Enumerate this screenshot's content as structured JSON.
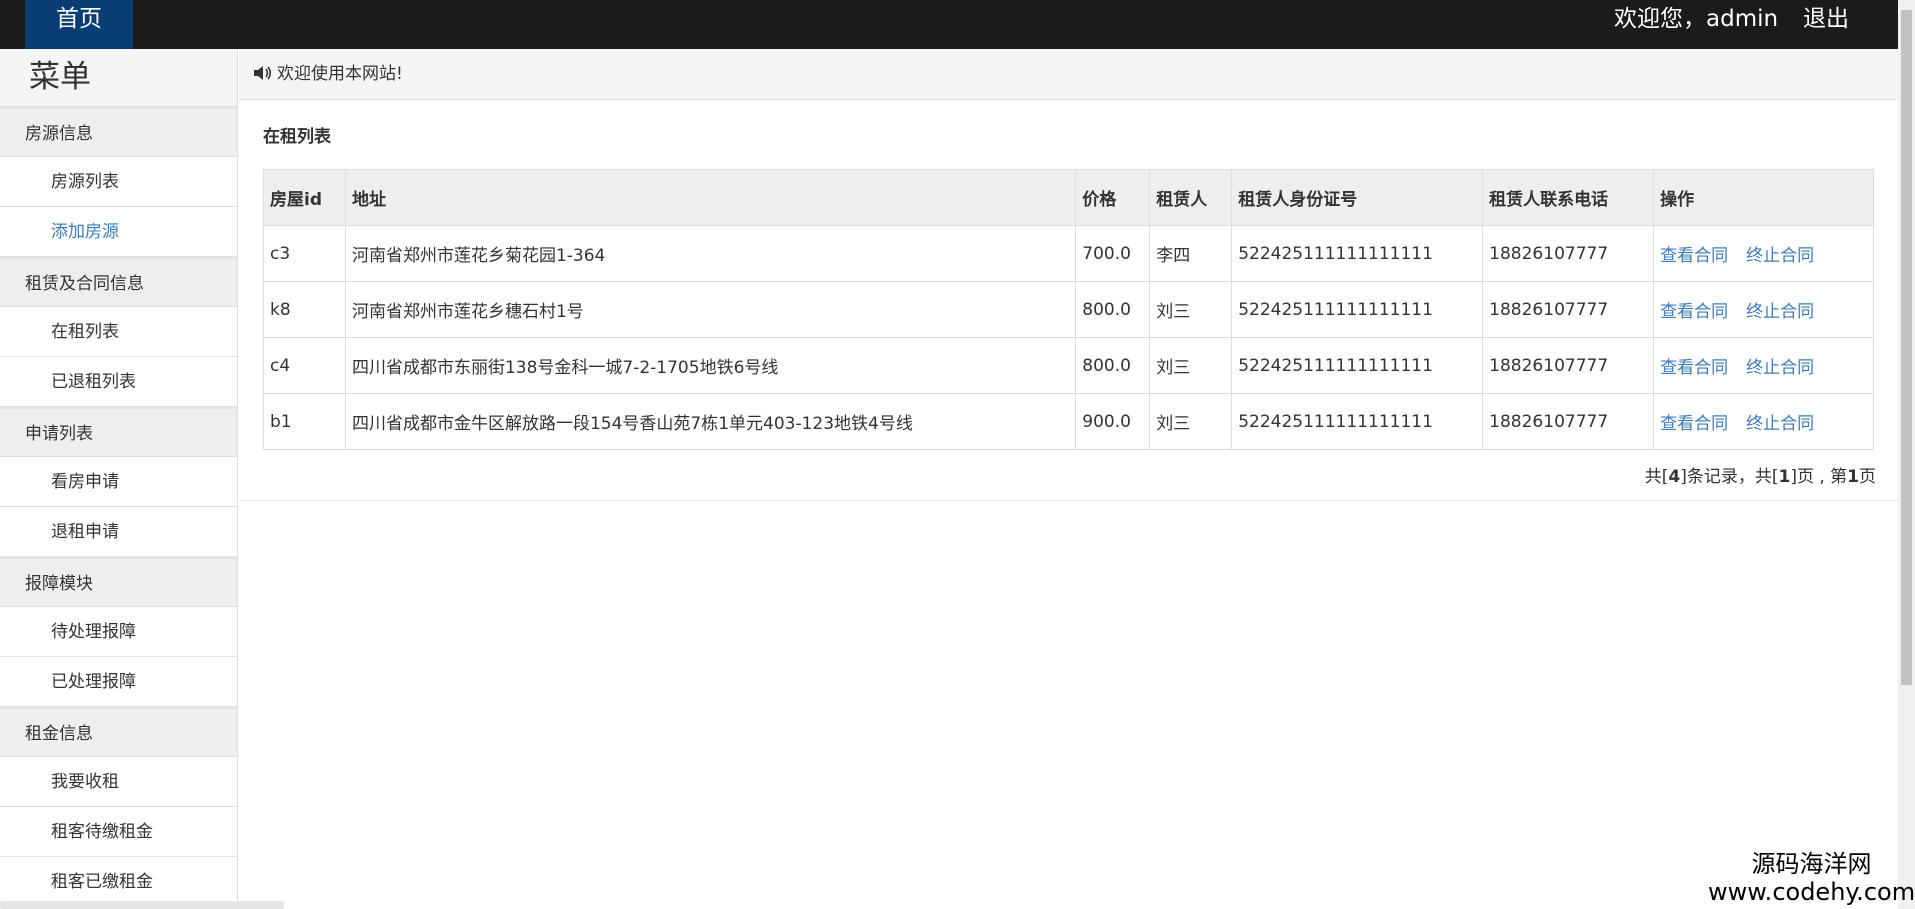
{
  "topbar": {
    "home_label": "首页",
    "welcome_text": "欢迎您，admin",
    "logout_label": "退出"
  },
  "sidebar": {
    "menu_title": "菜单",
    "groups": [
      {
        "label": "房源信息",
        "items": [
          {
            "label": "房源列表"
          },
          {
            "label": "添加房源"
          }
        ]
      },
      {
        "label": "租赁及合同信息",
        "items": [
          {
            "label": "在租列表"
          },
          {
            "label": "已退租列表"
          }
        ]
      },
      {
        "label": "申请列表",
        "items": [
          {
            "label": "看房申请"
          },
          {
            "label": "退租申请"
          }
        ]
      },
      {
        "label": "报障模块",
        "items": [
          {
            "label": "待处理报障"
          },
          {
            "label": "已处理报障"
          }
        ]
      },
      {
        "label": "租金信息",
        "items": [
          {
            "label": "我要收租"
          },
          {
            "label": "租客待缴租金"
          },
          {
            "label": "租客已缴租金"
          }
        ]
      }
    ]
  },
  "notice": {
    "icon": "speaker-icon",
    "text": "欢迎使用本网站!"
  },
  "panel": {
    "title": "在租列表",
    "columns": [
      "房屋id",
      "地址",
      "价格",
      "租赁人",
      "租赁人身份证号",
      "租赁人联系电话",
      "操作"
    ],
    "rows": [
      {
        "id": "c3",
        "address": "河南省郑州市莲花乡菊花园1-364",
        "price": "700.0",
        "tenant": "李四",
        "idcard": "522425111111111111",
        "phone": "18826107777",
        "view": "查看合同",
        "stop": "终止合同"
      },
      {
        "id": "k8",
        "address": "河南省郑州市莲花乡穗石村1号",
        "price": "800.0",
        "tenant": "刘三",
        "idcard": "522425111111111111",
        "phone": "18826107777",
        "view": "查看合同",
        "stop": "终止合同"
      },
      {
        "id": "c4",
        "address": "四川省成都市东丽街138号金科一城7-2-1705地铁6号线",
        "price": "800.0",
        "tenant": "刘三",
        "idcard": "522425111111111111",
        "phone": "18826107777",
        "view": "查看合同",
        "stop": "终止合同"
      },
      {
        "id": "b1",
        "address": "四川省成都市金牛区解放路一段154号香山苑7栋1单元403-123地铁4号线",
        "price": "900.0",
        "tenant": "刘三",
        "idcard": "522425111111111111",
        "phone": "18826107777",
        "view": "查看合同",
        "stop": "终止合同"
      }
    ],
    "pagination": {
      "prefix": "共[",
      "total": "4",
      "mid1": "]条记录，共[",
      "pages": "1",
      "mid2": "]页 , 第",
      "current": "1",
      "suffix": "页"
    }
  },
  "watermark": {
    "line1": "源码海洋网",
    "line2": "www.codehy.com"
  },
  "colors": {
    "topbar": "#1b1b1b",
    "home_tab": "#0a3d73",
    "link": "#3b7cb8"
  }
}
